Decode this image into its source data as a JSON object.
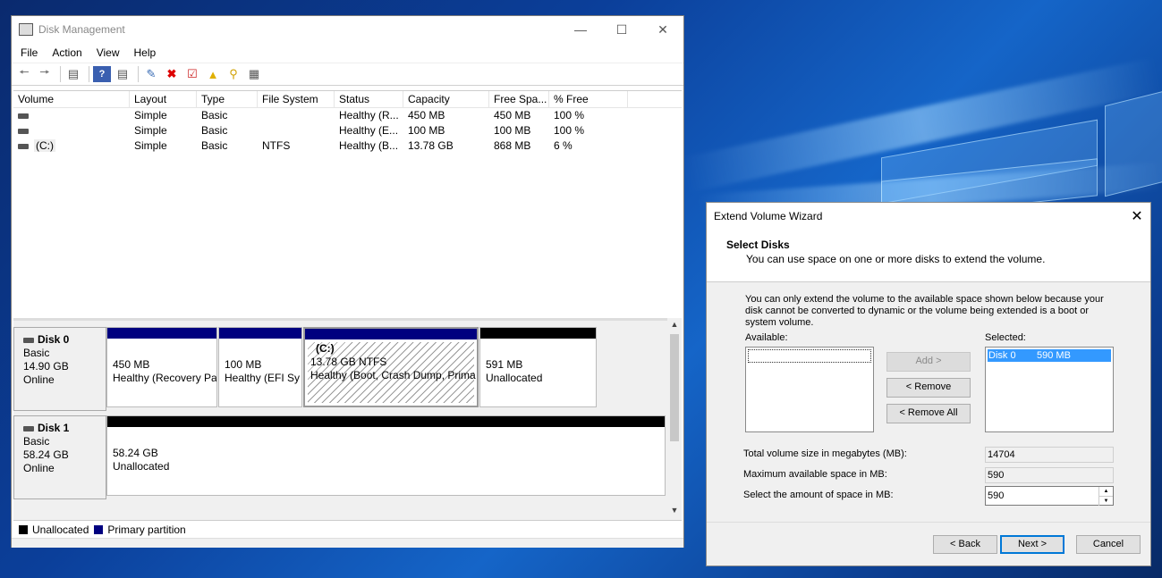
{
  "dm": {
    "title": "Disk Management",
    "menu": [
      "File",
      "Action",
      "View",
      "Help"
    ],
    "columns": [
      "Volume",
      "Layout",
      "Type",
      "File System",
      "Status",
      "Capacity",
      "Free Spa...",
      "% Free"
    ],
    "rows": [
      {
        "volume": "",
        "layout": "Simple",
        "type": "Basic",
        "fs": "",
        "status": "Healthy (R...",
        "capacity": "450 MB",
        "free": "450 MB",
        "pct": "100 %"
      },
      {
        "volume": "",
        "layout": "Simple",
        "type": "Basic",
        "fs": "",
        "status": "Healthy (E...",
        "capacity": "100 MB",
        "free": "100 MB",
        "pct": "100 %"
      },
      {
        "volume": "(C:)",
        "layout": "Simple",
        "type": "Basic",
        "fs": "NTFS",
        "status": "Healthy (B...",
        "capacity": "13.78 GB",
        "free": "868 MB",
        "pct": "6 %"
      }
    ],
    "disk0": {
      "name": "Disk 0",
      "type": "Basic",
      "size": "14.90 GB",
      "state": "Online"
    },
    "disk1": {
      "name": "Disk 1",
      "type": "Basic",
      "size": "58.24 GB",
      "state": "Online"
    },
    "parts0": [
      {
        "label": "",
        "size": "450 MB",
        "status": "Healthy (Recovery Pa"
      },
      {
        "label": "",
        "size": "100 MB",
        "status": "Healthy (EFI Sy"
      },
      {
        "label": "(C:)",
        "size": "13.78 GB NTFS",
        "status": "Healthy (Boot, Crash Dump, Prima"
      },
      {
        "label": "",
        "size": "591 MB",
        "status": "Unallocated"
      }
    ],
    "parts1": [
      {
        "size": "58.24 GB",
        "status": "Unallocated"
      }
    ],
    "legend": {
      "unallocated": "Unallocated",
      "primary": "Primary partition"
    },
    "colors": {
      "primary": "#00007f",
      "unallocated": "#000000"
    }
  },
  "wiz": {
    "title": "Extend Volume Wizard",
    "heading": "Select Disks",
    "subheading": "You can use space on one or more disks to extend the volume.",
    "info": "You can only extend the volume to the available space shown below because your disk cannot be converted to dynamic or the volume being extended is a boot or system volume.",
    "available_label": "Available:",
    "selected_label": "Selected:",
    "selected_item": {
      "disk": "Disk 0",
      "size": "590 MB"
    },
    "add": "Add >",
    "remove": "< Remove",
    "remove_all": "< Remove All",
    "total_label": "Total volume size in megabytes (MB):",
    "total_value": "14704",
    "max_label": "Maximum available space in MB:",
    "max_value": "590",
    "amount_label": "Select the amount of space in MB:",
    "amount_value": "590",
    "back": "< Back",
    "next": "Next >",
    "cancel": "Cancel"
  }
}
